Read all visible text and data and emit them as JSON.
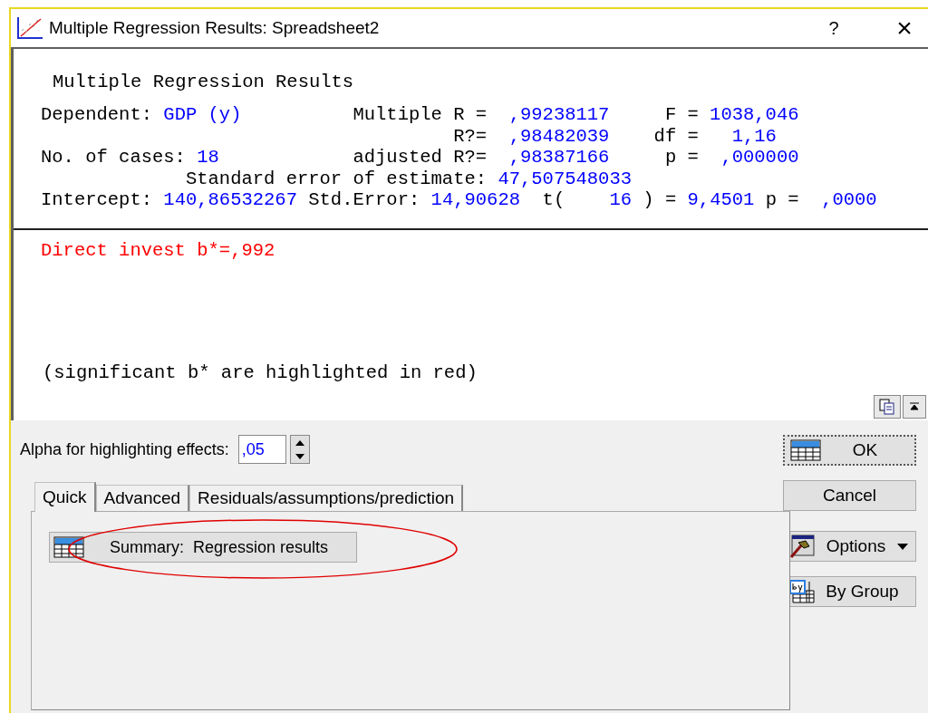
{
  "window": {
    "title": "Multiple Regression Results: Spreadsheet2",
    "help": "?",
    "close": "×"
  },
  "results": {
    "heading": "Multiple Regression Results",
    "lines": [
      [
        {
          "kind": "label",
          "text": "Dependent:"
        },
        {
          "kind": "value",
          "text": "GDP (y)"
        },
        {
          "kind": "label",
          "text": "Multiple R ="
        },
        {
          "kind": "value",
          "text": ",99238117"
        },
        {
          "kind": "label",
          "text": "F ="
        },
        {
          "kind": "value",
          "text": "1038,046"
        }
      ],
      [
        {
          "kind": "label",
          "text": "R?="
        },
        {
          "kind": "value",
          "text": ",98482039"
        },
        {
          "kind": "label",
          "text": "df ="
        },
        {
          "kind": "value",
          "text": "1,16"
        }
      ],
      [
        {
          "kind": "label",
          "text": "No. of cases:"
        },
        {
          "kind": "value",
          "text": "18"
        },
        {
          "kind": "label",
          "text": "adjusted R?="
        },
        {
          "kind": "value",
          "text": ",98387166"
        },
        {
          "kind": "label",
          "text": "p ="
        },
        {
          "kind": "value",
          "text": ",000000"
        }
      ],
      [
        {
          "kind": "label",
          "text": "Standard error of estimate:"
        },
        {
          "kind": "value",
          "text": "47,507548033"
        }
      ],
      [
        {
          "kind": "label",
          "text": "Intercept:"
        },
        {
          "kind": "value",
          "text": "140,86532267"
        },
        {
          "kind": "label",
          "text": "Std.Error:"
        },
        {
          "kind": "value",
          "text": "14,90628"
        },
        {
          "kind": "label",
          "text": "t("
        },
        {
          "kind": "value",
          "text": "16"
        },
        {
          "kind": "label",
          "text": ")"
        },
        {
          "kind": "label",
          "text": "="
        },
        {
          "kind": "value",
          "text": "9,4501"
        },
        {
          "kind": "label",
          "text": "p ="
        },
        {
          "kind": "value",
          "text": ",0000"
        }
      ]
    ],
    "effects": [
      {
        "text": "Direct invest b*=,992",
        "significant": true
      }
    ],
    "note": "(significant b* are highlighted in red)"
  },
  "alpha": {
    "label": "Alpha for highlighting effects:",
    "value": ",05"
  },
  "tabs": [
    {
      "label": "Quick",
      "selected": true
    },
    {
      "label": "Advanced",
      "selected": false
    },
    {
      "label": "Residuals/assumptions/prediction",
      "selected": false
    }
  ],
  "quick_buttons": [
    {
      "label": "Summary:  Regression results",
      "circled": true
    }
  ],
  "buttons": [
    {
      "kind": "ok",
      "label": "OK",
      "focused": true
    },
    {
      "kind": "cancel",
      "label": "Cancel",
      "focused": false
    },
    {
      "kind": "options",
      "label": "Options",
      "focused": false
    },
    {
      "kind": "bygroup",
      "label": "By Group",
      "focused": false
    }
  ]
}
